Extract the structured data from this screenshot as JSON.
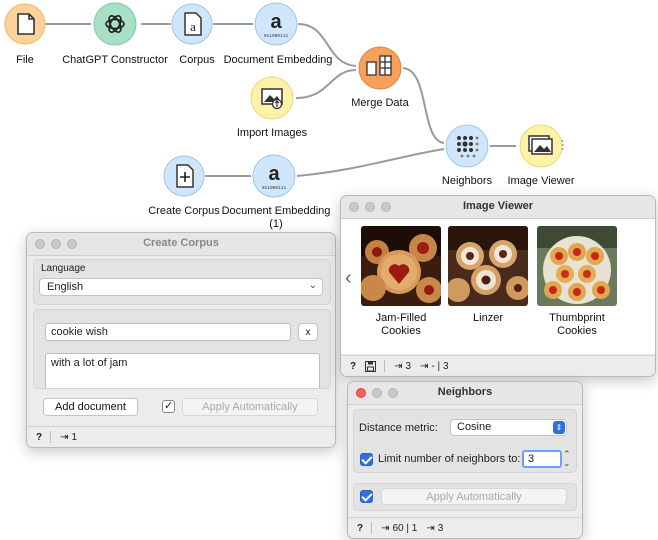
{
  "workflow": {
    "nodes": [
      {
        "id": "file",
        "label": "File",
        "icon": "file-icon",
        "color": "#fbd29a"
      },
      {
        "id": "chatgpt",
        "label": "ChatGPT Constructor",
        "icon": "openai-icon",
        "color": "#a8e0c4"
      },
      {
        "id": "corpus",
        "label": "Corpus",
        "icon": "corpus-icon",
        "color": "#cfe6fb"
      },
      {
        "id": "docemb",
        "label": "Document Embedding",
        "icon": "document-embedding-icon",
        "color": "#cfe6fb"
      },
      {
        "id": "merge",
        "label": "Merge Data",
        "icon": "merge-data-icon",
        "color": "#f5a15a"
      },
      {
        "id": "importimg",
        "label": "Import Images",
        "icon": "import-images-icon",
        "color": "#fcf3a8"
      },
      {
        "id": "neighbors",
        "label": "Neighbors",
        "icon": "neighbors-icon",
        "color": "#cfe6fb"
      },
      {
        "id": "imgviewer",
        "label": "Image Viewer",
        "icon": "image-viewer-icon",
        "color": "#fcf3a8"
      },
      {
        "id": "createcorpus",
        "label": "Create Corpus",
        "icon": "create-corpus-icon",
        "color": "#cfe6fb"
      },
      {
        "id": "docemb1",
        "label": "Document Embedding (1)",
        "icon": "document-embedding-icon",
        "color": "#cfe6fb"
      }
    ],
    "embedding_glyph": "a",
    "embedding_bits": "011000111"
  },
  "image_viewer": {
    "title": "Image Viewer",
    "nav_left": "‹",
    "images": [
      {
        "caption": "Jam-Filled Cookies"
      },
      {
        "caption": "Linzer"
      },
      {
        "caption": "Thumbprint Cookies"
      }
    ],
    "status": {
      "help": "?",
      "input": "3",
      "output": "- | 3"
    }
  },
  "create_corpus": {
    "title": "Create Corpus",
    "language_label": "Language",
    "language_value": "English",
    "title_value": "cookie wish",
    "clear_label": "x",
    "text_value": "with a lot of jam",
    "add_document_label": "Add document",
    "apply_label": "Apply Automatically",
    "status": {
      "help": "?",
      "output": "1"
    }
  },
  "neighbors": {
    "title": "Neighbors",
    "distance_label": "Distance metric:",
    "distance_value": "Cosine",
    "limit_label": "Limit number of neighbors to:",
    "limit_value": "3",
    "apply_label": "Apply Automatically",
    "status": {
      "help": "?",
      "input": "60 | 1",
      "output": "3"
    }
  },
  "colors": {
    "accent": "#2f6fde",
    "close": "#ff5f57",
    "blue_node": "#cfe6fb",
    "orange_node": "#f5a15a",
    "yellow_node": "#fcf3a8"
  }
}
